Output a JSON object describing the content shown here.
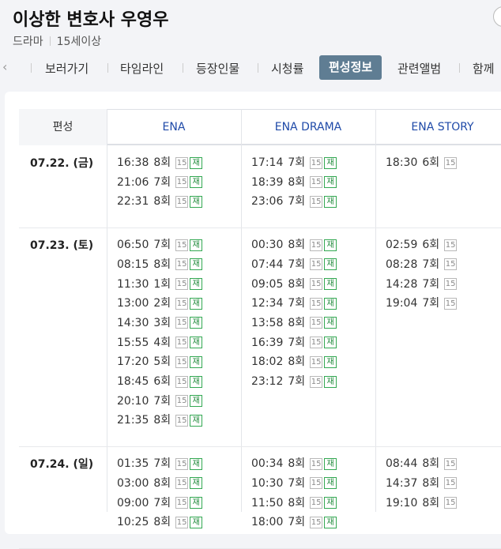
{
  "title": "이상한 변호사 우영우",
  "meta": {
    "genre": "드라마",
    "rating": "15세이상"
  },
  "tabs": [
    {
      "label": "보러가기"
    },
    {
      "label": "타임라인"
    },
    {
      "label": "등장인물"
    },
    {
      "label": "시청률"
    },
    {
      "label": "편성정보"
    },
    {
      "label": "관련앨범"
    },
    {
      "label": "함께"
    }
  ],
  "nav": {
    "prev_icon": "chevron-left"
  },
  "table": {
    "headers": [
      "편성",
      "ENA",
      "ENA DRAMA",
      "ENA STORY"
    ],
    "badge15": "15",
    "badge_re": "재",
    "rows": [
      {
        "date": "07.22. (금)",
        "channels": [
          [
            {
              "time": "16:38",
              "ep": "8회",
              "re": true
            },
            {
              "time": "21:06",
              "ep": "7회",
              "re": true
            },
            {
              "time": "22:31",
              "ep": "8회",
              "re": true
            }
          ],
          [
            {
              "time": "17:14",
              "ep": "7회",
              "re": true
            },
            {
              "time": "18:39",
              "ep": "8회",
              "re": true
            },
            {
              "time": "23:06",
              "ep": "7회",
              "re": true
            }
          ],
          [
            {
              "time": "18:30",
              "ep": "6회",
              "re": false
            }
          ]
        ]
      },
      {
        "date": "07.23. (토)",
        "channels": [
          [
            {
              "time": "06:50",
              "ep": "7회",
              "re": true
            },
            {
              "time": "08:15",
              "ep": "8회",
              "re": true
            },
            {
              "time": "11:30",
              "ep": "1회",
              "re": true
            },
            {
              "time": "13:00",
              "ep": "2회",
              "re": true
            },
            {
              "time": "14:30",
              "ep": "3회",
              "re": true
            },
            {
              "time": "15:55",
              "ep": "4회",
              "re": true
            },
            {
              "time": "17:20",
              "ep": "5회",
              "re": true
            },
            {
              "time": "18:45",
              "ep": "6회",
              "re": true
            },
            {
              "time": "20:10",
              "ep": "7회",
              "re": true
            },
            {
              "time": "21:35",
              "ep": "8회",
              "re": true
            }
          ],
          [
            {
              "time": "00:30",
              "ep": "8회",
              "re": true
            },
            {
              "time": "07:44",
              "ep": "7회",
              "re": true
            },
            {
              "time": "09:05",
              "ep": "8회",
              "re": true
            },
            {
              "time": "12:34",
              "ep": "7회",
              "re": true
            },
            {
              "time": "13:58",
              "ep": "8회",
              "re": true
            },
            {
              "time": "16:39",
              "ep": "7회",
              "re": true
            },
            {
              "time": "18:02",
              "ep": "8회",
              "re": true
            },
            {
              "time": "23:12",
              "ep": "7회",
              "re": true
            }
          ],
          [
            {
              "time": "02:59",
              "ep": "6회",
              "re": false
            },
            {
              "time": "08:28",
              "ep": "7회",
              "re": false
            },
            {
              "time": "14:28",
              "ep": "7회",
              "re": false
            },
            {
              "time": "19:04",
              "ep": "7회",
              "re": false
            }
          ]
        ]
      },
      {
        "date": "07.24. (일)",
        "channels": [
          [
            {
              "time": "01:35",
              "ep": "7회",
              "re": true
            },
            {
              "time": "03:00",
              "ep": "8회",
              "re": true
            },
            {
              "time": "09:00",
              "ep": "7회",
              "re": true
            },
            {
              "time": "10:25",
              "ep": "8회",
              "re": true
            }
          ],
          [
            {
              "time": "00:34",
              "ep": "8회",
              "re": true
            },
            {
              "time": "10:30",
              "ep": "7회",
              "re": true
            },
            {
              "time": "11:50",
              "ep": "8회",
              "re": true
            },
            {
              "time": "18:00",
              "ep": "7회",
              "re": true
            }
          ],
          [
            {
              "time": "08:44",
              "ep": "8회",
              "re": false
            },
            {
              "time": "14:37",
              "ep": "8회",
              "re": false
            },
            {
              "time": "19:10",
              "ep": "8회",
              "re": false
            }
          ]
        ]
      }
    ]
  },
  "colors": {
    "active_tab_bg": "#5f7d93",
    "header_text": "#1f4aa8",
    "rerun_green": "#1f8a3a"
  }
}
